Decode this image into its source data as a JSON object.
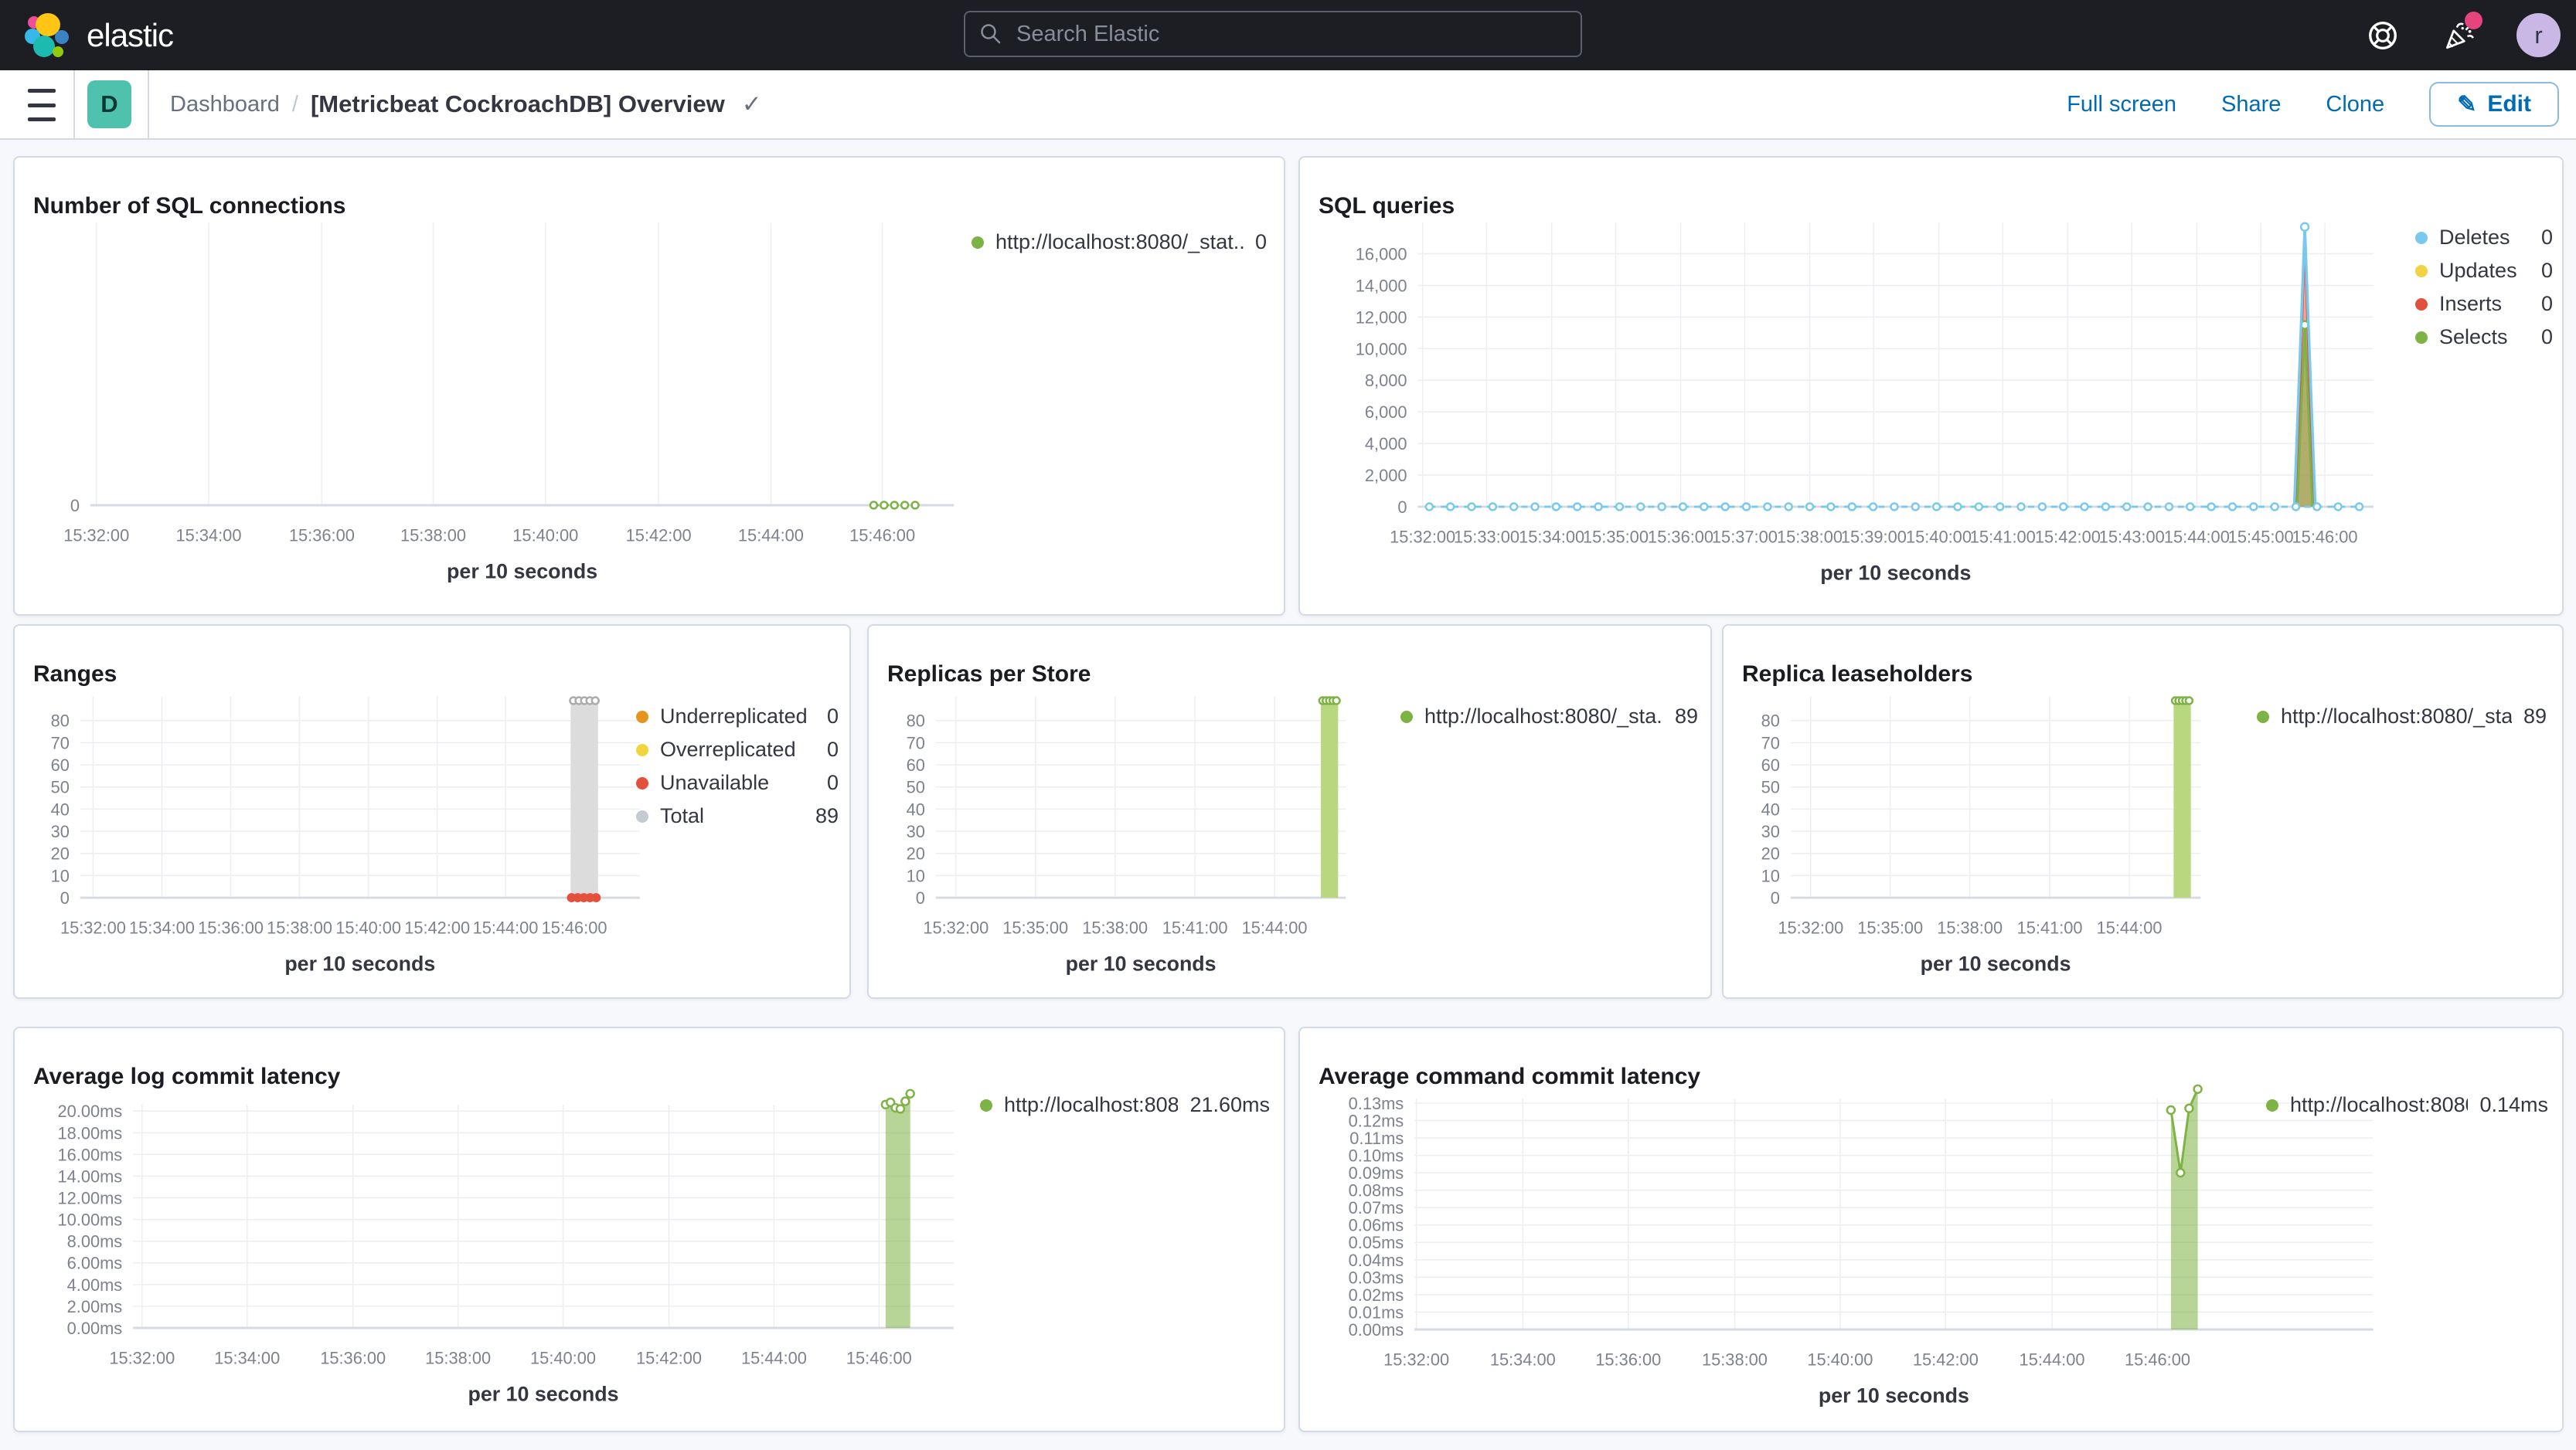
{
  "topbar": {
    "brand": "elastic",
    "search_placeholder": "Search Elastic",
    "avatar_initial": "r"
  },
  "toolbar": {
    "breadcrumb_root": "Dashboard",
    "breadcrumb_sep": "/",
    "title": "[Metricbeat CockroachDB] Overview",
    "title_check": "✓",
    "deployment_letter": "D",
    "actions": [
      "Full screen",
      "Share",
      "Clone"
    ],
    "edit_label": "Edit",
    "edit_icon": "✎"
  },
  "colors": {
    "green": "#7DB344",
    "blue": "#79C9EE",
    "yellow": "#F1D344",
    "red": "#E0503C",
    "orange": "#E8941C",
    "gray": "#C6CAD1",
    "link": "#006BB4",
    "accent_badge": "#E6447D"
  },
  "panels": [
    {
      "title": "Number of SQL connections",
      "legend": [
        {
          "color": "#7DB344",
          "label": "http://localhost:8080/_stat...",
          "value": "0"
        }
      ],
      "chart": {
        "type": "line",
        "size": [
          1646,
          595
        ],
        "plot": {
          "l": 95,
          "t": 85,
          "r": 1220,
          "b": 453
        },
        "ylim": [
          0,
          1
        ],
        "yticks": [
          {
            "v": 0,
            "label": "0"
          }
        ],
        "xticks": [
          {
            "f": 0.007,
            "label": "15:32:00"
          },
          {
            "f": 0.137,
            "label": "15:34:00"
          },
          {
            "f": 0.268,
            "label": "15:36:00"
          },
          {
            "f": 0.397,
            "label": "15:38:00"
          },
          {
            "f": 0.527,
            "label": "15:40:00"
          },
          {
            "f": 0.658,
            "label": "15:42:00"
          },
          {
            "f": 0.788,
            "label": "15:44:00"
          },
          {
            "f": 0.917,
            "label": "15:46:00"
          }
        ],
        "xlabel": "per 10 seconds",
        "series": [
          {
            "kind": "flat",
            "v": 0,
            "from": 0.907,
            "to": 0.955,
            "color": "#7DB344",
            "width": 3,
            "dash": "7,6",
            "markers": 5
          }
        ]
      }
    },
    {
      "title": "SQL queries",
      "legend": [
        {
          "color": "#79C9EE",
          "label": "Deletes",
          "value": "0"
        },
        {
          "color": "#F1D344",
          "label": "Updates",
          "value": "0"
        },
        {
          "color": "#E0503C",
          "label": "Inserts",
          "value": "0"
        },
        {
          "color": "#7DB344",
          "label": "Selects",
          "value": "0"
        }
      ],
      "chart": {
        "type": "line",
        "size": [
          1637,
          595
        ],
        "plot": {
          "l": 150,
          "t": 85,
          "r": 1395,
          "b": 455
        },
        "ylim": [
          0,
          17960
        ],
        "yticks": [
          {
            "v": 0,
            "label": "0"
          },
          {
            "v": 2000,
            "label": "2,000"
          },
          {
            "v": 4000,
            "label": "4,000"
          },
          {
            "v": 6000,
            "label": "6,000"
          },
          {
            "v": 8000,
            "label": "8,000"
          },
          {
            "v": 10000,
            "label": "10,000"
          },
          {
            "v": 12000,
            "label": "12,000"
          },
          {
            "v": 14000,
            "label": "14,000"
          },
          {
            "v": 16000,
            "label": "16,000"
          }
        ],
        "xticks": [
          {
            "f": 0.005,
            "label": "15:32:00"
          },
          {
            "f": 0.072,
            "label": "15:33:00"
          },
          {
            "f": 0.14,
            "label": "15:34:00"
          },
          {
            "f": 0.207,
            "label": "15:35:00"
          },
          {
            "f": 0.275,
            "label": "15:36:00"
          },
          {
            "f": 0.342,
            "label": "15:37:00"
          },
          {
            "f": 0.41,
            "label": "15:38:00"
          },
          {
            "f": 0.477,
            "label": "15:39:00"
          },
          {
            "f": 0.545,
            "label": "15:40:00"
          },
          {
            "f": 0.612,
            "label": "15:41:00"
          },
          {
            "f": 0.68,
            "label": "15:42:00"
          },
          {
            "f": 0.747,
            "label": "15:43:00"
          },
          {
            "f": 0.815,
            "label": "15:44:00"
          },
          {
            "f": 0.882,
            "label": "15:45:00"
          },
          {
            "f": 0.949,
            "label": "15:46:00"
          }
        ],
        "xlabel": "per 10 seconds",
        "series": [
          {
            "kind": "line",
            "points": [
              [
                0.919,
                0
              ],
              [
                0.928,
                17000
              ],
              [
                0.937,
                0
              ]
            ],
            "color": "#E0503C",
            "width": 3,
            "fill": "rgba(224,80,60,0.5)"
          },
          {
            "kind": "line",
            "points": [
              [
                0.92,
                0
              ],
              [
                0.928,
                11500
              ],
              [
                0.936,
                0
              ]
            ],
            "color": "#7DB344",
            "width": 3,
            "fill": "rgba(125,179,68,0.55)",
            "markers": "apex"
          },
          {
            "kind": "line",
            "points": [
              [
                0.917,
                0
              ],
              [
                0.928,
                17700
              ],
              [
                0.939,
                0
              ]
            ],
            "color": "#79C9EE",
            "width": 3.5,
            "markers": "apex"
          },
          {
            "kind": "flat",
            "v": 0,
            "from": 0.012,
            "to": 0.985,
            "color": "#79C9EE",
            "width": 3,
            "dash": "8,7",
            "markers": 45
          }
        ]
      }
    },
    {
      "title": "Ranges",
      "legend": [
        {
          "color": "#E8941C",
          "label": "Underreplicated",
          "value": "0"
        },
        {
          "color": "#F2D53A",
          "label": "Overreplicated",
          "value": "0"
        },
        {
          "color": "#E5503C",
          "label": "Unavailable",
          "value": "0"
        },
        {
          "color": "#C6CAD1",
          "label": "Total",
          "value": "89"
        }
      ],
      "chart": {
        "type": "bar",
        "size": [
          1084,
          485
        ],
        "plot": {
          "l": 83,
          "t": 92,
          "r": 813,
          "b": 355
        },
        "ylim": [
          0,
          91
        ],
        "yticks": [
          {
            "v": 0,
            "label": "0"
          },
          {
            "v": 10,
            "label": "10"
          },
          {
            "v": 20,
            "label": "20"
          },
          {
            "v": 30,
            "label": "30"
          },
          {
            "v": 40,
            "label": "40"
          },
          {
            "v": 50,
            "label": "50"
          },
          {
            "v": 60,
            "label": "60"
          },
          {
            "v": 70,
            "label": "70"
          },
          {
            "v": 80,
            "label": "80"
          }
        ],
        "xticks": [
          {
            "f": 0.023,
            "label": "15:32:00"
          },
          {
            "f": 0.146,
            "label": "15:34:00"
          },
          {
            "f": 0.269,
            "label": "15:36:00"
          },
          {
            "f": 0.392,
            "label": "15:38:00"
          },
          {
            "f": 0.515,
            "label": "15:40:00"
          },
          {
            "f": 0.638,
            "label": "15:42:00"
          },
          {
            "f": 0.76,
            "label": "15:44:00"
          },
          {
            "f": 0.883,
            "label": "15:46:00"
          }
        ],
        "xlabel": "per 10 seconds",
        "series": [
          {
            "kind": "bar",
            "f": 0.901,
            "wf": 0.049,
            "v": 89,
            "color": "#DCDCDC",
            "topmarkers": 5,
            "marker_color": "#ABABAB"
          },
          {
            "kind": "dots",
            "points": [
              [
                0.878,
                0
              ],
              [
                0.889,
                0
              ],
              [
                0.9,
                0
              ],
              [
                0.911,
                0
              ],
              [
                0.922,
                0
              ]
            ],
            "color": "#E5503C",
            "r": 6
          }
        ]
      }
    },
    {
      "title": "Replicas per Store",
      "legend": [
        {
          "color": "#7DB344",
          "label": "http://localhost:8080/_sta...",
          "value": "89"
        }
      ],
      "chart": {
        "type": "bar",
        "size": [
          1093,
          485
        ],
        "plot": {
          "l": 85,
          "t": 92,
          "r": 620,
          "b": 355
        },
        "ylim": [
          0,
          91
        ],
        "yticks": [
          {
            "v": 0,
            "label": "0"
          },
          {
            "v": 10,
            "label": "10"
          },
          {
            "v": 20,
            "label": "20"
          },
          {
            "v": 30,
            "label": "30"
          },
          {
            "v": 40,
            "label": "40"
          },
          {
            "v": 50,
            "label": "50"
          },
          {
            "v": 60,
            "label": "60"
          },
          {
            "v": 70,
            "label": "70"
          },
          {
            "v": 80,
            "label": "80"
          }
        ],
        "xticks": [
          {
            "f": 0.049,
            "label": "15:32:00"
          },
          {
            "f": 0.243,
            "label": "15:35:00"
          },
          {
            "f": 0.437,
            "label": "15:38:00"
          },
          {
            "f": 0.632,
            "label": "15:41:00"
          },
          {
            "f": 0.826,
            "label": "15:44:00"
          }
        ],
        "xlabel": "per 10 seconds",
        "series": [
          {
            "kind": "bar",
            "f": 0.96,
            "wf": 0.042,
            "v": 89,
            "color": "#B8D77E",
            "topmarkers": 5,
            "marker_color": "#7DB344"
          }
        ]
      }
    },
    {
      "title": "Replica leaseholders",
      "legend": [
        {
          "color": "#7DB344",
          "label": "http://localhost:8080/_sta...",
          "value": "89"
        }
      ],
      "chart": {
        "type": "bar",
        "size": [
          1089,
          485
        ],
        "plot": {
          "l": 85,
          "t": 92,
          "r": 620,
          "b": 355
        },
        "ylim": [
          0,
          91
        ],
        "yticks": [
          {
            "v": 0,
            "label": "0"
          },
          {
            "v": 10,
            "label": "10"
          },
          {
            "v": 20,
            "label": "20"
          },
          {
            "v": 30,
            "label": "30"
          },
          {
            "v": 40,
            "label": "40"
          },
          {
            "v": 50,
            "label": "50"
          },
          {
            "v": 60,
            "label": "60"
          },
          {
            "v": 70,
            "label": "70"
          },
          {
            "v": 80,
            "label": "80"
          }
        ],
        "xticks": [
          {
            "f": 0.049,
            "label": "15:32:00"
          },
          {
            "f": 0.243,
            "label": "15:35:00"
          },
          {
            "f": 0.437,
            "label": "15:38:00"
          },
          {
            "f": 0.632,
            "label": "15:41:00"
          },
          {
            "f": 0.826,
            "label": "15:44:00"
          }
        ],
        "xlabel": "per 10 seconds",
        "series": [
          {
            "kind": "bar",
            "f": 0.955,
            "wf": 0.042,
            "v": 89,
            "color": "#B8D77E",
            "topmarkers": 5,
            "marker_color": "#7DB344"
          }
        ]
      }
    },
    {
      "title": "Average log commit latency",
      "legend": [
        {
          "color": "#7DB344",
          "label": "http://localhost:808...",
          "value": "21.60ms"
        }
      ],
      "chart": {
        "type": "area",
        "size": [
          1646,
          525
        ],
        "plot": {
          "l": 150,
          "t": 100,
          "r": 1220,
          "b": 391
        },
        "ylim": [
          0,
          20.57
        ],
        "yticks": [
          {
            "v": 0,
            "label": "0.00ms"
          },
          {
            "v": 2,
            "label": "2.00ms"
          },
          {
            "v": 4,
            "label": "4.00ms"
          },
          {
            "v": 6,
            "label": "6.00ms"
          },
          {
            "v": 8,
            "label": "8.00ms"
          },
          {
            "v": 10,
            "label": "10.00ms"
          },
          {
            "v": 12,
            "label": "12.00ms"
          },
          {
            "v": 14,
            "label": "14.00ms"
          },
          {
            "v": 16,
            "label": "16.00ms"
          },
          {
            "v": 18,
            "label": "18.00ms"
          },
          {
            "v": 20,
            "label": "20.00ms"
          }
        ],
        "xticks": [
          {
            "f": 0.011,
            "label": "15:32:00"
          },
          {
            "f": 0.139,
            "label": "15:34:00"
          },
          {
            "f": 0.268,
            "label": "15:36:00"
          },
          {
            "f": 0.396,
            "label": "15:38:00"
          },
          {
            "f": 0.524,
            "label": "15:40:00"
          },
          {
            "f": 0.653,
            "label": "15:42:00"
          },
          {
            "f": 0.781,
            "label": "15:44:00"
          },
          {
            "f": 0.909,
            "label": "15:46:00"
          }
        ],
        "xlabel": "per 10 seconds",
        "series": [
          {
            "kind": "line",
            "points": [
              [
                0.917,
                20.6
              ],
              [
                0.923,
                20.8
              ],
              [
                0.929,
                20.3
              ],
              [
                0.935,
                20.2
              ],
              [
                0.941,
                20.9
              ],
              [
                0.947,
                21.6
              ]
            ],
            "color": "#7DB344",
            "width": 3,
            "fill": "rgba(125,179,68,0.55)",
            "markers": "open"
          }
        ]
      }
    },
    {
      "title": "Average command commit latency",
      "legend": [
        {
          "color": "#7DB344",
          "label": "http://localhost:8080...",
          "value": "0.14ms"
        }
      ],
      "chart": {
        "type": "area",
        "size": [
          1637,
          525
        ],
        "plot": {
          "l": 145,
          "t": 92,
          "r": 1395,
          "b": 393
        },
        "ylim": [
          0,
          0.1325
        ],
        "yticks": [
          {
            "v": 0,
            "label": "0.00ms"
          },
          {
            "v": 0.01,
            "label": "0.01ms"
          },
          {
            "v": 0.02,
            "label": "0.02ms"
          },
          {
            "v": 0.03,
            "label": "0.03ms"
          },
          {
            "v": 0.04,
            "label": "0.04ms"
          },
          {
            "v": 0.05,
            "label": "0.05ms"
          },
          {
            "v": 0.06,
            "label": "0.06ms"
          },
          {
            "v": 0.07,
            "label": "0.07ms"
          },
          {
            "v": 0.08,
            "label": "0.08ms"
          },
          {
            "v": 0.09,
            "label": "0.09ms"
          },
          {
            "v": 0.1,
            "label": "0.10ms"
          },
          {
            "v": 0.11,
            "label": "0.11ms"
          },
          {
            "v": 0.12,
            "label": "0.12ms"
          },
          {
            "v": 0.13,
            "label": "0.13ms"
          }
        ],
        "xticks": [
          {
            "f": 0.002,
            "label": "15:32:00"
          },
          {
            "f": 0.113,
            "label": "15:34:00"
          },
          {
            "f": 0.223,
            "label": "15:36:00"
          },
          {
            "f": 0.334,
            "label": "15:38:00"
          },
          {
            "f": 0.444,
            "label": "15:40:00"
          },
          {
            "f": 0.554,
            "label": "15:42:00"
          },
          {
            "f": 0.665,
            "label": "15:44:00"
          },
          {
            "f": 0.775,
            "label": "15:46:00"
          }
        ],
        "xlabel": "per 10 seconds",
        "series": [
          {
            "kind": "line",
            "points": [
              [
                0.789,
                0.126
              ],
              [
                0.799,
                0.09
              ],
              [
                0.808,
                0.127
              ],
              [
                0.817,
                0.138
              ]
            ],
            "color": "#7DB344",
            "width": 3,
            "fill": "rgba(125,179,68,0.55)",
            "markers": "open"
          }
        ]
      }
    }
  ]
}
